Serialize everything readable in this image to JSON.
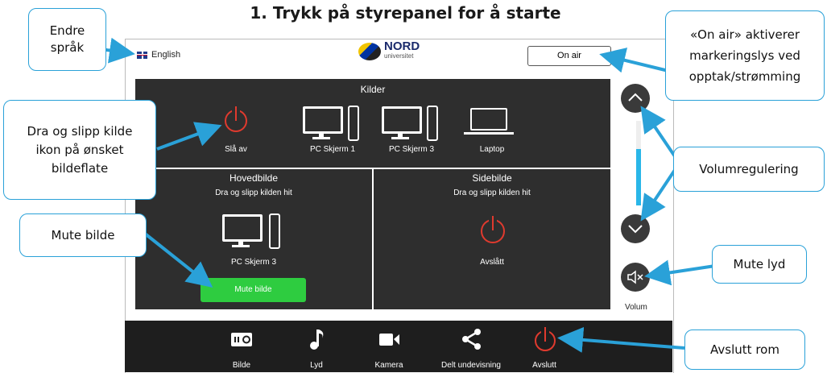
{
  "heading": "1.   Trykk på styrepanel for å starte",
  "tablet": {
    "language": "English",
    "logo": {
      "name": "NORD",
      "sub": "universitet"
    },
    "onair_label": "On air",
    "sources": {
      "title": "Kilder",
      "items": [
        {
          "label": "Slå av",
          "icon": "power-icon"
        },
        {
          "label": "PC Skjerm 1",
          "icon": "monitor-icon"
        },
        {
          "label": "PC Skjerm 3",
          "icon": "monitor-icon"
        },
        {
          "label": "Laptop",
          "icon": "laptop-icon"
        }
      ]
    },
    "main_display": {
      "title": "Hovedbilde",
      "hint": "Dra og slipp kilden hit",
      "source_label": "PC Skjerm 3",
      "mute_label": "Mute bilde"
    },
    "side_display": {
      "title": "Sidebilde",
      "hint": "Dra og slipp kilden hit",
      "status": "Avslått"
    },
    "volume_label": "Volum",
    "nav": [
      {
        "label": "Bilde",
        "icon": "projector-icon"
      },
      {
        "label": "Lyd",
        "icon": "music-note-icon"
      },
      {
        "label": "Kamera",
        "icon": "video-camera-icon"
      },
      {
        "label": "Delt undevisning",
        "icon": "share-icon"
      },
      {
        "label": "Avslutt",
        "icon": "power-icon"
      }
    ]
  },
  "callouts": {
    "language": "Endre\nspråk",
    "drag": "Dra og slipp kilde\nikon på ønsket\nbildeflate",
    "mute_image": "Mute bilde",
    "onair": "«On air» aktiverer\nmarkeringslys ved\nopptak/strømming",
    "volume": "Volumregulering",
    "mute_sound": "Mute lyd",
    "exit": "Avslutt rom"
  },
  "colors": {
    "accent": "#2aa1d8",
    "power": "#e03a2e",
    "mute_green": "#2ecc40",
    "panel": "#2e2e2e"
  }
}
